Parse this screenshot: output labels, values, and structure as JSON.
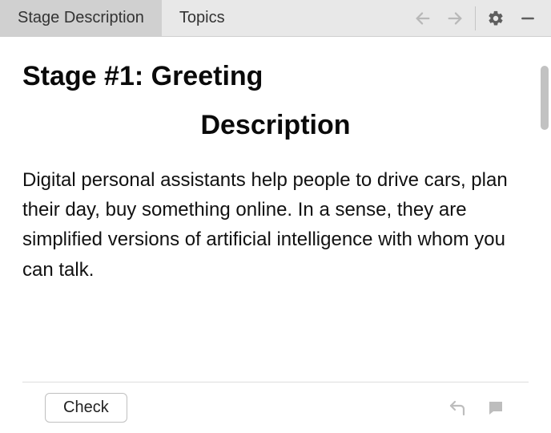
{
  "tabs": {
    "stage_description": "Stage Description",
    "topics": "Topics"
  },
  "content": {
    "heading": "Stage #1: Greeting",
    "subheading": "Description",
    "body": "Digital personal assistants help people to drive cars, plan their day, buy something online. In a sense, they are simplified versions of artificial intelligence with whom you can talk."
  },
  "footer": {
    "check_label": "Check"
  }
}
